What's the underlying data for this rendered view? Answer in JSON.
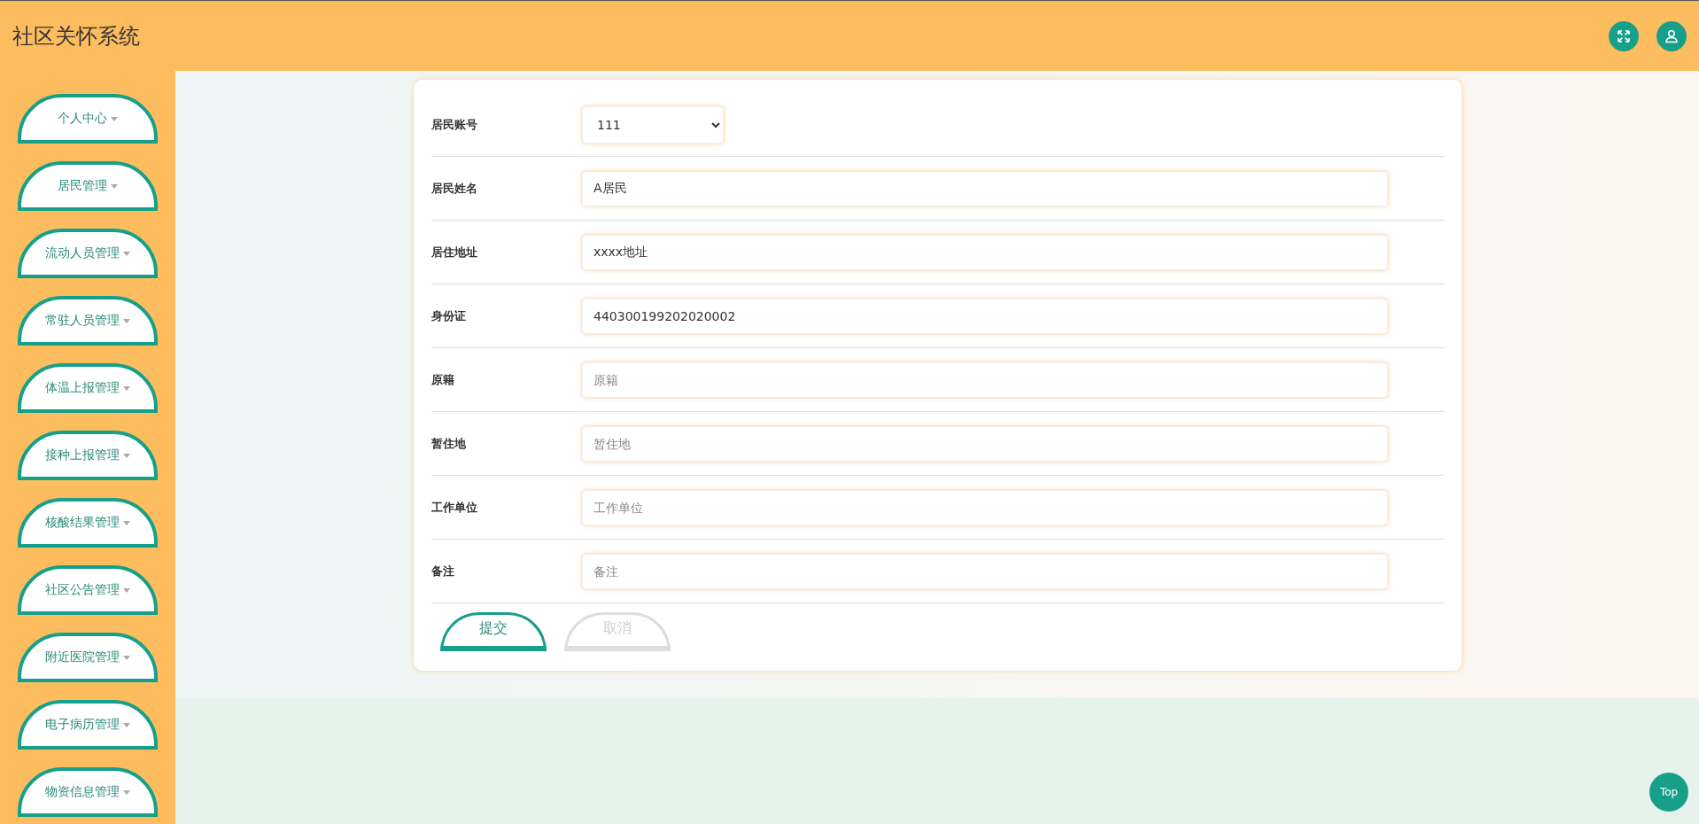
{
  "header": {
    "title": "社区关怀系统"
  },
  "sidebar": {
    "items": [
      {
        "label": "个人中心"
      },
      {
        "label": "居民管理"
      },
      {
        "label": "流动人员管理"
      },
      {
        "label": "常驻人员管理"
      },
      {
        "label": "体温上报管理"
      },
      {
        "label": "接种上报管理"
      },
      {
        "label": "核酸结果管理"
      },
      {
        "label": "社区公告管理"
      },
      {
        "label": "附近医院管理"
      },
      {
        "label": "电子病历管理"
      },
      {
        "label": "物资信息管理"
      }
    ]
  },
  "form": {
    "fields": [
      {
        "label": "居民账号",
        "kind": "select",
        "value": "111"
      },
      {
        "label": "居民姓名",
        "kind": "input",
        "value": "A居民"
      },
      {
        "label": "居住地址",
        "kind": "input",
        "value": "xxxx地址"
      },
      {
        "label": "身份证",
        "kind": "input",
        "value": "440300199202020002"
      },
      {
        "label": "原籍",
        "kind": "input",
        "placeholder": "原籍"
      },
      {
        "label": "暂住地",
        "kind": "input",
        "placeholder": "暂住地"
      },
      {
        "label": "工作单位",
        "kind": "input",
        "placeholder": "工作单位"
      },
      {
        "label": "备注",
        "kind": "input",
        "placeholder": "备注"
      }
    ],
    "buttons": [
      {
        "label": "提交",
        "kind": "primary"
      },
      {
        "label": "取消",
        "kind": "secondary"
      }
    ]
  },
  "back_to_top": {
    "label": "Top"
  }
}
